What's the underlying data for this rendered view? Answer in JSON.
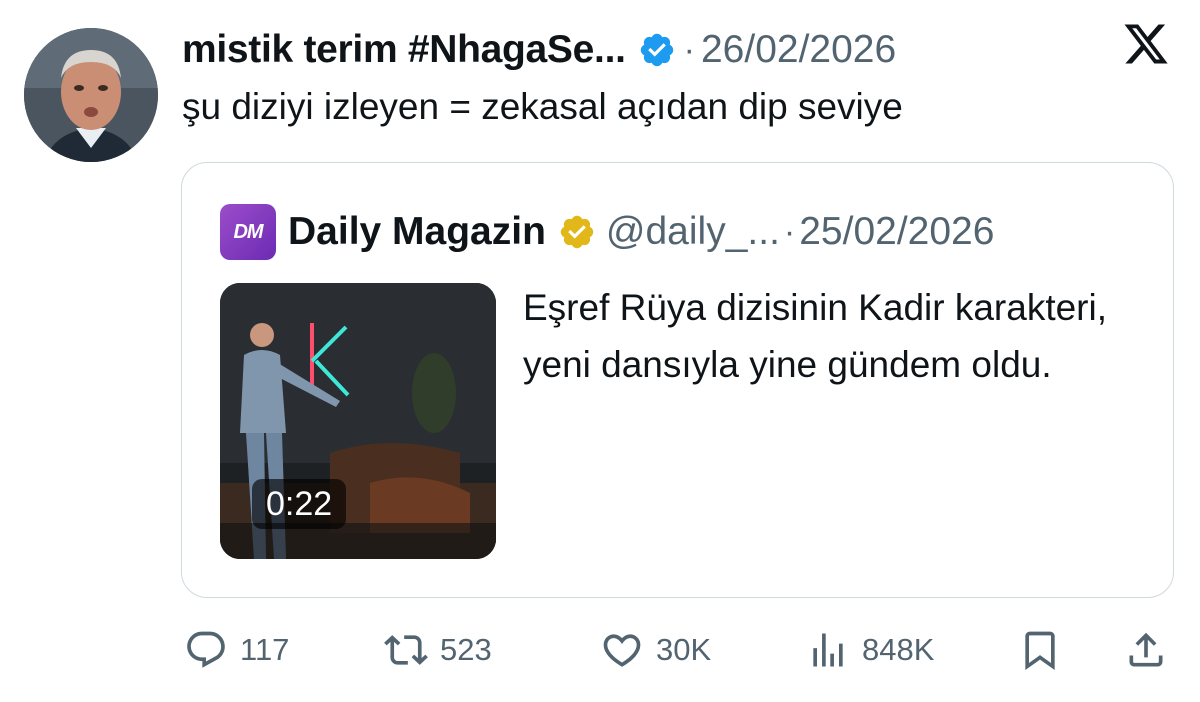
{
  "tweet": {
    "author_name": "mistik terim #NhagaSe...",
    "separator": "·",
    "date": "26/02/2026",
    "text": "şu diziyi izleyen = zekasal açıdan dip seviye"
  },
  "quote": {
    "avatar_text": "DM",
    "author_name": "Daily Magazin",
    "handle": "@daily_...",
    "separator": "·",
    "date": "25/02/2026",
    "text": "Eşref Rüya dizisinin Kadir karakteri, yeni dansıyla yine gündem oldu.",
    "video_duration": "0:22"
  },
  "actions": {
    "replies": "117",
    "retweets": "523",
    "likes": "30K",
    "views": "848K"
  },
  "icons": {
    "verified": "verified-badge-icon",
    "verified_org": "verified-gold-badge-icon",
    "platform": "x-logo-icon",
    "reply": "reply-icon",
    "retweet": "retweet-icon",
    "like": "heart-icon",
    "views": "views-icon",
    "bookmark": "bookmark-icon",
    "share": "share-icon"
  },
  "colors": {
    "verified_blue": "#1d9bf0",
    "verified_gold": "#e2b719",
    "muted_text": "#536471",
    "border": "#cfd9de",
    "brand_purple": "#8a3fc4"
  }
}
